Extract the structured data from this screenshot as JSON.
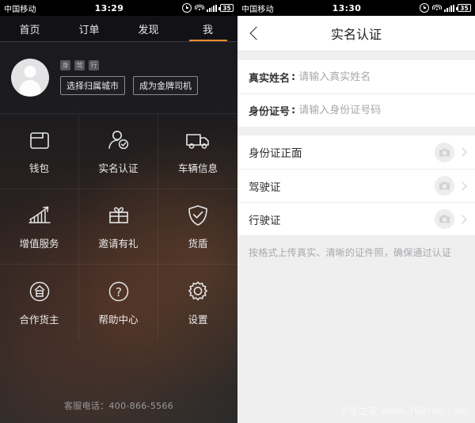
{
  "left": {
    "statusbar": {
      "carrier": "中国移动",
      "time": "13:29",
      "battery": "35",
      "icons": [
        "alarm-icon",
        "wifi-icon",
        "signal-icon",
        "battery-icon"
      ]
    },
    "tabs": [
      {
        "label": "首页",
        "active": false
      },
      {
        "label": "订单",
        "active": false
      },
      {
        "label": "发现",
        "active": false
      },
      {
        "label": "我",
        "active": true
      }
    ],
    "profile": {
      "avatar": "user-avatar-placeholder",
      "badges": [
        "身",
        "驾",
        "行"
      ],
      "buttons": [
        {
          "label": "选择归属城市"
        },
        {
          "label": "成为金牌司机"
        }
      ]
    },
    "grid": [
      {
        "label": "钱包",
        "icon": "wallet-icon"
      },
      {
        "label": "实名认证",
        "icon": "user-verified-icon"
      },
      {
        "label": "车辆信息",
        "icon": "truck-icon"
      },
      {
        "label": "增值服务",
        "icon": "chart-growth-icon"
      },
      {
        "label": "邀请有礼",
        "icon": "gift-icon"
      },
      {
        "label": "货盾",
        "icon": "shield-check-icon"
      },
      {
        "label": "合作货主",
        "icon": "cooperation-circle-icon"
      },
      {
        "label": "帮助中心",
        "icon": "question-circle-icon"
      },
      {
        "label": "设置",
        "icon": "gear-icon"
      }
    ],
    "footer": {
      "service_phone": "客服电话：400-866-5566"
    }
  },
  "right": {
    "statusbar": {
      "carrier": "中国移动",
      "time": "13:30",
      "battery": "35",
      "icons": [
        "alarm-icon",
        "wifi-icon",
        "signal-icon",
        "battery-icon"
      ]
    },
    "titlebar": {
      "back": "back-chevron-icon",
      "title": "实名认证"
    },
    "form": [
      {
        "label": "真实姓名",
        "colon": ":",
        "value": "",
        "placeholder": "请输入真实姓名"
      },
      {
        "label": "身份证号",
        "colon": ":",
        "value": "",
        "placeholder": "请输入身份证号码"
      }
    ],
    "uploads": [
      {
        "label": "身份证正面",
        "icon": "camera-icon",
        "chevron": "chevron-right-icon"
      },
      {
        "label": "驾驶证",
        "icon": "camera-icon",
        "chevron": "chevron-right-icon"
      },
      {
        "label": "行驶证",
        "icon": "camera-icon",
        "chevron": "chevron-right-icon"
      }
    ],
    "hint": "按格式上传真实、清晰的证件照，确保通过认证",
    "watermark": "卡车之家 www.360che.com"
  },
  "colors": {
    "accent_orange": "#ea8c2a",
    "left_bg_dark": "#1c1b1e",
    "right_bg_grey": "#efeff0",
    "card_white": "#ffffff"
  }
}
